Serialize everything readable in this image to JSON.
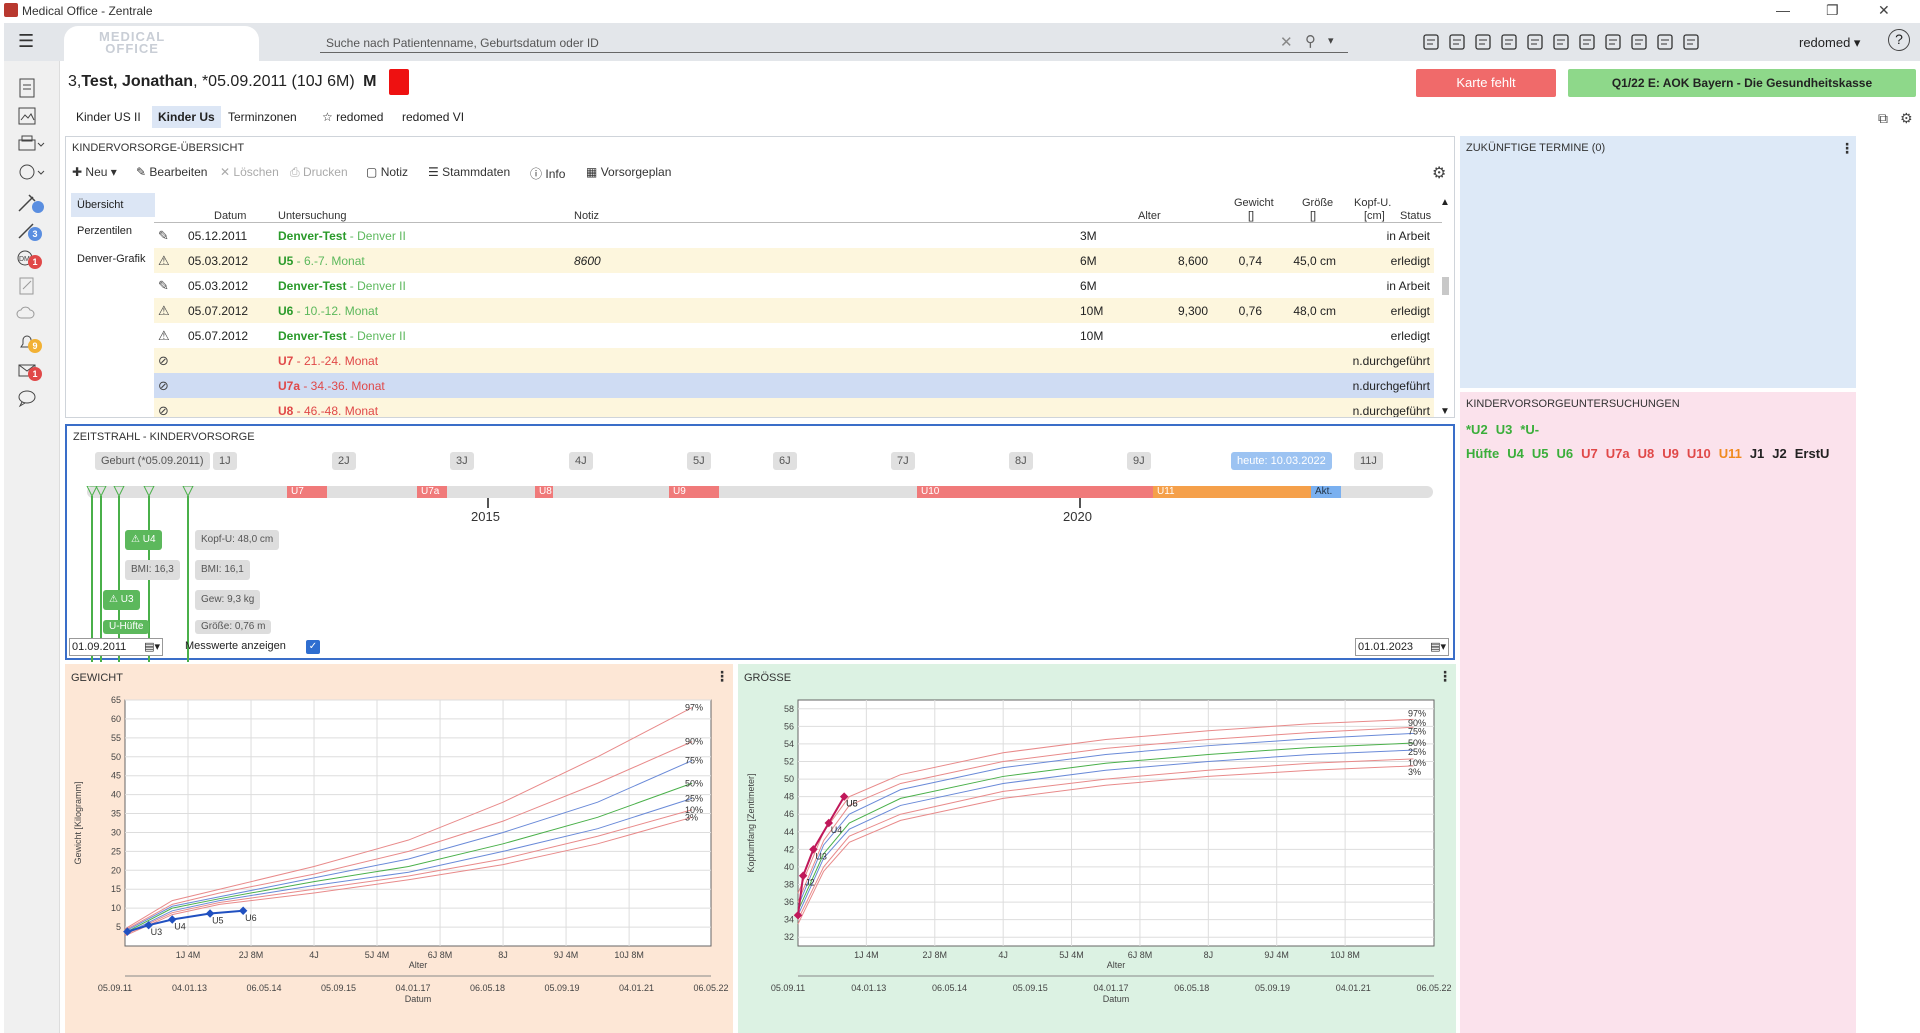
{
  "window": {
    "title": "Medical Office - Zentrale"
  },
  "appbar": {
    "logo_line1": "MEDICAL",
    "logo_line2": "OFFICE",
    "search_placeholder": "Suche nach Patientenname, Geburtsdatum oder ID",
    "user": "redomed",
    "icons": [
      "card-icon",
      "patients-icon",
      "group-icon",
      "printer-icon",
      "scan-icon",
      "document-icon",
      "stamp-icon",
      "mail-icon",
      "chart-icon",
      "chat-icon",
      "notes-icon"
    ]
  },
  "sidebar": {
    "badges": [
      "3",
      "1",
      "9",
      "1"
    ]
  },
  "patient": {
    "prefix": "3,",
    "name": "Test, Jonathan",
    "dob": ", *05.09.2011 (10J 6M)",
    "sex": "M",
    "status_button": "Karte fehlt",
    "insurance_button": "Q1/22 E: AOK Bayern - Die Gesundheitskasse",
    "tabs": [
      "Kinder US II",
      "Kinder Us",
      "Terminzonen",
      "redomed",
      "redomed VI"
    ],
    "active_tab": "Kinder Us"
  },
  "overview": {
    "title": "KINDERVORSORGE-ÜBERSICHT",
    "toolbar": [
      "Neu",
      "Bearbeiten",
      "Löschen",
      "Drucken",
      "Notiz",
      "Stammdaten",
      "Info",
      "Vorsorgeplan"
    ],
    "side_nav": [
      "Übersicht",
      "Perzentilen",
      "Denver-Grafik"
    ],
    "columns": {
      "datum": "Datum",
      "untersuchung": "Untersuchung",
      "notiz": "Notiz",
      "alter": "Alter",
      "gewicht": "Gewicht",
      "gewicht_unit": "[]",
      "groesse": "Größe",
      "groesse_unit": "[]",
      "kopf": "Kopf-U.",
      "kopf_unit": "[cm]",
      "status": "Status"
    },
    "rows": [
      {
        "datum": "05.12.2011",
        "name": "Denver-Test",
        "sub": " - Denver II",
        "notiz": "",
        "alter": "3M",
        "gewicht": "",
        "groesse": "",
        "kopf": "",
        "status": "in Arbeit",
        "kind": "green",
        "icon": "edit"
      },
      {
        "datum": "05.03.2012",
        "name": "U5",
        "sub": " - 6.-7. Monat",
        "notiz": "8600",
        "alter": "6M",
        "gewicht": "8,600",
        "groesse": "0,74",
        "kopf": "45,0 cm",
        "status": "erledigt",
        "kind": "green",
        "icon": "child"
      },
      {
        "datum": "05.03.2012",
        "name": "Denver-Test",
        "sub": " - Denver II",
        "notiz": "",
        "alter": "6M",
        "gewicht": "",
        "groesse": "",
        "kopf": "",
        "status": "in Arbeit",
        "kind": "green",
        "icon": "edit"
      },
      {
        "datum": "05.07.2012",
        "name": "U6",
        "sub": " - 10.-12. Monat",
        "notiz": "",
        "alter": "10M",
        "gewicht": "9,300",
        "groesse": "0,76",
        "kopf": "48,0 cm",
        "status": "erledigt",
        "kind": "green",
        "icon": "child"
      },
      {
        "datum": "05.07.2012",
        "name": "Denver-Test",
        "sub": " - Denver II",
        "notiz": "",
        "alter": "10M",
        "gewicht": "",
        "groesse": "",
        "kopf": "",
        "status": "erledigt",
        "kind": "green",
        "icon": "child"
      },
      {
        "datum": "",
        "name": "U7",
        "sub": " - 21.-24. Monat",
        "notiz": "",
        "alter": "",
        "gewicht": "",
        "groesse": "",
        "kopf": "",
        "status": "n.durchgeführt",
        "kind": "red",
        "icon": "none"
      },
      {
        "datum": "",
        "name": "U7a",
        "sub": " - 34.-36. Monat",
        "notiz": "",
        "alter": "",
        "gewicht": "",
        "groesse": "",
        "kopf": "",
        "status": "n.durchgeführt",
        "kind": "red",
        "icon": "none"
      },
      {
        "datum": "",
        "name": "U8",
        "sub": " - 46.-48. Monat",
        "notiz": "",
        "alter": "",
        "gewicht": "",
        "groesse": "",
        "kopf": "",
        "status": "n.durchgeführt",
        "kind": "red",
        "icon": "none"
      }
    ]
  },
  "termine": {
    "title": "ZUKÜNFTIGE TERMINE (0)"
  },
  "untersuchungen": {
    "title": "KINDERVORSORGEUNTERSUCHUNGEN",
    "items": [
      {
        "label": "*U2",
        "color": "green"
      },
      {
        "label": "U3",
        "color": "green"
      },
      {
        "label": "*U-Hüfte",
        "color": "green"
      },
      {
        "label": "U4",
        "color": "green"
      },
      {
        "label": "U5",
        "color": "green"
      },
      {
        "label": "U6",
        "color": "green"
      },
      {
        "label": "U7",
        "color": "red"
      },
      {
        "label": "U7a",
        "color": "red"
      },
      {
        "label": "U8",
        "color": "red"
      },
      {
        "label": "U9",
        "color": "red"
      },
      {
        "label": "U10",
        "color": "red"
      },
      {
        "label": "U11",
        "color": "orange"
      },
      {
        "label": "J1",
        "color": "dark"
      },
      {
        "label": "J2",
        "color": "dark"
      },
      {
        "label": "ErstU",
        "color": "dark"
      }
    ]
  },
  "timeline": {
    "title": "ZEITSTRAHL - KINDERVORSORGE",
    "birth_label": "Geburt (*05.09.2011)",
    "age_labels": [
      "1J",
      "2J",
      "3J",
      "4J",
      "5J",
      "6J",
      "7J",
      "8J",
      "9J",
      "11J"
    ],
    "today_label": "heute: 10.03.2022",
    "bars": [
      {
        "label": "U7",
        "color": "#f07a7a"
      },
      {
        "label": "U7a",
        "color": "#f07a7a"
      },
      {
        "label": "U8",
        "color": "#f07a7a"
      },
      {
        "label": "U9",
        "color": "#f07a7a"
      },
      {
        "label": "U10",
        "color": "#f07a7a"
      },
      {
        "label": "U11",
        "color": "#f5a04a"
      },
      {
        "label": "Akt.",
        "color": "#7ab0f0"
      }
    ],
    "year_labels": [
      "2015",
      "2020"
    ],
    "measurements": [
      {
        "label": "U4",
        "kind": "green"
      },
      {
        "label": "Kopf-U: 48,0 cm",
        "kind": "gray"
      },
      {
        "label": "BMI: 16,3",
        "kind": "gray"
      },
      {
        "label": "BMI: 16,1",
        "kind": "gray"
      },
      {
        "label": "U3",
        "kind": "green"
      },
      {
        "label": "Gew: 9,3 kg",
        "kind": "gray"
      },
      {
        "label": "U-Hüfte",
        "kind": "green"
      },
      {
        "label": "Größe: 0,76 m",
        "kind": "gray"
      }
    ],
    "from_date": "01.09.2011",
    "to_date": "01.01.2023",
    "checkbox_label": "Messwerte anzeigen",
    "checkbox_checked": true
  },
  "chart_data": [
    {
      "type": "line",
      "title": "GEWICHT",
      "ylabel": "Gewicht [Kilogramm]",
      "xlabel": "Alter",
      "xlabel2": "Datum",
      "ylim": [
        0,
        65
      ],
      "yticks": [
        5,
        10,
        15,
        20,
        25,
        30,
        35,
        40,
        45,
        50,
        55,
        60,
        65
      ],
      "xticks_age": [
        "1J 4M",
        "2J 8M",
        "4J",
        "5J 4M",
        "6J 8M",
        "8J",
        "9J 4M",
        "10J 8M"
      ],
      "xticks_date": [
        "05.09.11",
        "04.01.13",
        "06.05.14",
        "05.09.15",
        "04.01.17",
        "06.05.18",
        "05.09.19",
        "04.01.21",
        "06.05.22"
      ],
      "percentile_labels": [
        "97%",
        "90%",
        "75%",
        "50%",
        "25%",
        "10%",
        "3%"
      ],
      "series": [
        {
          "name": "97%",
          "color": "#e88a8a",
          "x": [
            0,
            1,
            2,
            4,
            6,
            8,
            10,
            12
          ],
          "values": [
            4.5,
            12,
            15,
            21,
            28,
            38,
            50,
            63
          ]
        },
        {
          "name": "90%",
          "color": "#e88a8a",
          "x": [
            0,
            1,
            2,
            4,
            6,
            8,
            10,
            12
          ],
          "values": [
            4.2,
            11,
            14,
            19,
            25,
            33,
            43,
            54
          ]
        },
        {
          "name": "75%",
          "color": "#6a8ad8",
          "x": [
            0,
            1,
            2,
            4,
            6,
            8,
            10,
            12
          ],
          "values": [
            3.9,
            10.5,
            13,
            18,
            23,
            30,
            38,
            49
          ]
        },
        {
          "name": "50%",
          "color": "#4ab04a",
          "x": [
            0,
            1,
            2,
            4,
            6,
            8,
            10,
            12
          ],
          "values": [
            3.5,
            10,
            12.5,
            17,
            21,
            27,
            34,
            43
          ]
        },
        {
          "name": "25%",
          "color": "#6a8ad8",
          "x": [
            0,
            1,
            2,
            4,
            6,
            8,
            10,
            12
          ],
          "values": [
            3.2,
            9.3,
            12,
            16,
            19.5,
            25,
            31,
            39
          ]
        },
        {
          "name": "10%",
          "color": "#e88a8a",
          "x": [
            0,
            1,
            2,
            4,
            6,
            8,
            10,
            12
          ],
          "values": [
            3.0,
            8.8,
            11.5,
            15,
            18.5,
            23,
            29,
            36
          ]
        },
        {
          "name": "3%",
          "color": "#e88a8a",
          "x": [
            0,
            1,
            2,
            4,
            6,
            8,
            10,
            12
          ],
          "values": [
            2.7,
            8.3,
            11,
            14,
            17.5,
            21.5,
            27,
            34
          ]
        }
      ],
      "measured": {
        "x": [
          0.05,
          0.5,
          1,
          1.8,
          2.5
        ],
        "values": [
          3.8,
          5.5,
          7,
          8.6,
          9.3
        ],
        "labels": [
          "U3",
          "U4",
          "U5",
          "U6"
        ]
      }
    },
    {
      "type": "line",
      "title": "GRÖSSE",
      "ylabel": "Kopfumfang [Zentimeter]",
      "xlabel": "Alter",
      "xlabel2": "Datum",
      "ylim": [
        31,
        59
      ],
      "yticks": [
        32,
        34,
        36,
        38,
        40,
        42,
        44,
        46,
        48,
        50,
        52,
        54,
        56,
        58
      ],
      "xticks_age": [
        "1J 4M",
        "2J 8M",
        "4J",
        "5J 4M",
        "6J 8M",
        "8J",
        "9J 4M",
        "10J 8M"
      ],
      "xticks_date": [
        "05.09.11",
        "04.01.13",
        "06.05.14",
        "05.09.15",
        "04.01.17",
        "06.05.18",
        "05.09.19",
        "04.01.21",
        "06.05.22"
      ],
      "percentile_labels": [
        "97%",
        "90%",
        "75%",
        "50%",
        "25%",
        "10%",
        "3%"
      ],
      "series": [
        {
          "name": "97%",
          "color": "#e88a8a",
          "x": [
            0,
            0.5,
            1,
            2,
            4,
            6,
            8,
            10,
            12
          ],
          "values": [
            37,
            44,
            48,
            50.5,
            53,
            54.5,
            55.5,
            56.3,
            56.8
          ]
        },
        {
          "name": "90%",
          "color": "#e88a8a",
          "x": [
            0,
            0.5,
            1,
            2,
            4,
            6,
            8,
            10,
            12
          ],
          "values": [
            36,
            43,
            47,
            49.5,
            52,
            53.5,
            54.5,
            55.3,
            55.9
          ]
        },
        {
          "name": "75%",
          "color": "#6a8ad8",
          "x": [
            0,
            0.5,
            1,
            2,
            4,
            6,
            8,
            10,
            12
          ],
          "values": [
            35.5,
            42.5,
            46,
            48.8,
            51.3,
            52.8,
            53.8,
            54.6,
            55.2
          ]
        },
        {
          "name": "50%",
          "color": "#4ab04a",
          "x": [
            0,
            0.5,
            1,
            2,
            4,
            6,
            8,
            10,
            12
          ],
          "values": [
            35,
            41.5,
            45,
            47.8,
            50.3,
            51.8,
            52.8,
            53.6,
            54.1
          ]
        },
        {
          "name": "25%",
          "color": "#6a8ad8",
          "x": [
            0,
            0.5,
            1,
            2,
            4,
            6,
            8,
            10,
            12
          ],
          "values": [
            34.5,
            41,
            44.3,
            47,
            49.5,
            51,
            52,
            52.8,
            53.3
          ]
        },
        {
          "name": "10%",
          "color": "#e88a8a",
          "x": [
            0,
            0.5,
            1,
            2,
            4,
            6,
            8,
            10,
            12
          ],
          "values": [
            34,
            40,
            43.5,
            46,
            48.6,
            50,
            51,
            51.8,
            52.3
          ]
        },
        {
          "name": "3%",
          "color": "#e88a8a",
          "x": [
            0,
            0.5,
            1,
            2,
            4,
            6,
            8,
            10,
            12
          ],
          "values": [
            33.5,
            39.5,
            42.8,
            45.3,
            47.8,
            49.3,
            50.3,
            51,
            51.5
          ]
        }
      ],
      "measured": {
        "x": [
          0,
          0.1,
          0.3,
          0.6,
          0.9
        ],
        "values": [
          34.5,
          39,
          42,
          45,
          48
        ],
        "labels": [
          "J2",
          "U3",
          "U4",
          "U5",
          "U6"
        ]
      }
    }
  ]
}
